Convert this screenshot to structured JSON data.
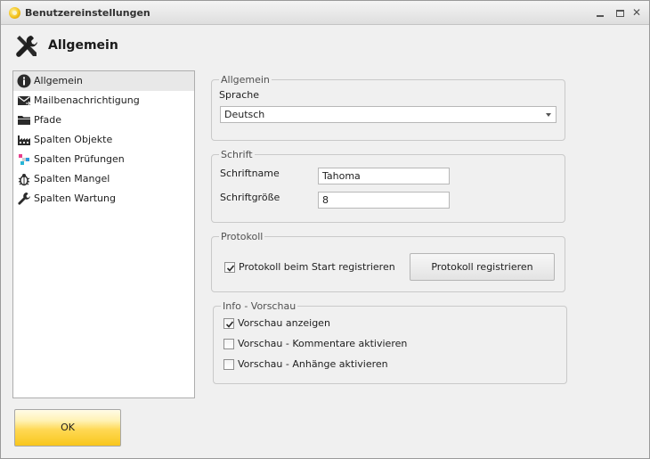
{
  "window": {
    "title": "Benutzereinstellungen"
  },
  "header": {
    "title": "Allgemein"
  },
  "sidebar": {
    "items": [
      {
        "label": "Allgemein",
        "icon": "info-icon",
        "selected": true
      },
      {
        "label": "Mailbenachrichtigung",
        "icon": "mail-icon",
        "selected": false
      },
      {
        "label": "Pfade",
        "icon": "folder-icon",
        "selected": false
      },
      {
        "label": "Spalten Objekte",
        "icon": "factory-icon",
        "selected": false
      },
      {
        "label": "Spalten Prüfungen",
        "icon": "colored-squares-icon",
        "selected": false
      },
      {
        "label": "Spalten Mangel",
        "icon": "bug-icon",
        "selected": false
      },
      {
        "label": "Spalten Wartung",
        "icon": "wrench-icon",
        "selected": false
      }
    ]
  },
  "general": {
    "legend": "Allgemein",
    "language_label": "Sprache",
    "language_value": "Deutsch"
  },
  "font": {
    "legend": "Schrift",
    "name_label": "Schriftname",
    "name_value": "Tahoma",
    "size_label": "Schriftgröße",
    "size_value": "8"
  },
  "protocol": {
    "legend": "Protokoll",
    "checkbox_label": "Protokoll beim Start registrieren",
    "checkbox_checked": true,
    "button_label": "Protokoll registrieren"
  },
  "preview": {
    "legend": "Info - Vorschau",
    "show_label": "Vorschau anzeigen",
    "show_checked": true,
    "comments_label": "Vorschau - Kommentare aktivieren",
    "comments_checked": false,
    "attachments_label": "Vorschau - Anhänge aktivieren",
    "attachments_checked": false
  },
  "footer": {
    "ok_label": "OK"
  },
  "colors": {
    "ok_button": "#f8c61c",
    "selected_item": "#e8e8e8"
  }
}
